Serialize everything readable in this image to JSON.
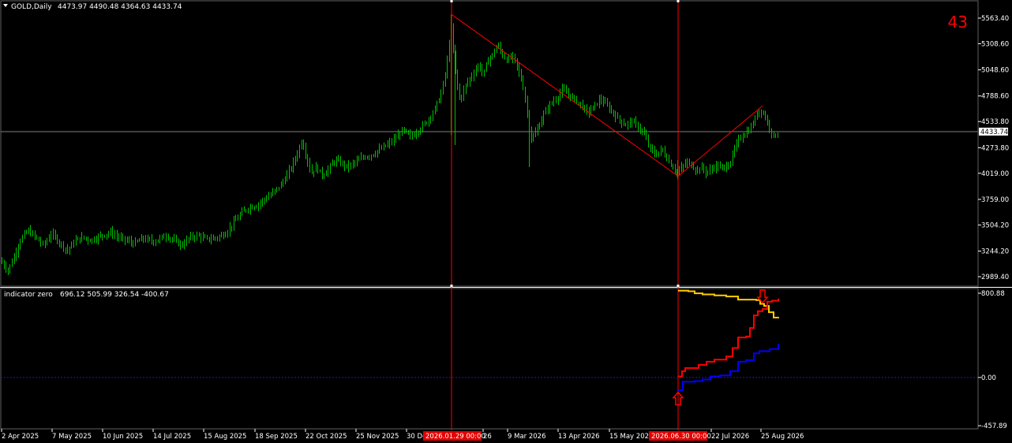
{
  "window": {
    "symbol_title": "GOLD,Daily",
    "ohlc": "4473.97 4490.48 4364.63 4433.74",
    "counter": "43"
  },
  "indicator": {
    "title": "indicator zero",
    "values": "696.12 505.99 326.54 -400.67"
  },
  "colors": {
    "background": "#000000",
    "candle": "#00c000",
    "price_line": "#808080",
    "vline": "#ff0000",
    "trend": "#ff0000",
    "ind_yellow": "#ffcc00",
    "ind_red": "#ff0000",
    "ind_blue": "#0000ff",
    "zero_line": "#2020a0"
  },
  "chart_data": [
    {
      "type": "candlestick",
      "title": "GOLD,Daily",
      "ylim": [
        2900,
        5650
      ],
      "y_ticks": [
        "5563.40",
        "5308.60",
        "5048.60",
        "4788.60",
        "4533.80",
        "4273.80",
        "4019.00",
        "3759.00",
        "3504.20",
        "3244.20",
        "2989.40"
      ],
      "y_tick_values": [
        5563.4,
        5308.6,
        5048.6,
        4788.6,
        4533.8,
        4273.8,
        4019.0,
        3759.0,
        3504.2,
        3244.2,
        2989.4
      ],
      "x_labels": [
        "2 Apr 2025",
        "7 May 2025",
        "10 Jun 2025",
        "14 Jul 2025",
        "15 Aug 2025",
        "18 Sep 2025",
        "22 Oct 2025",
        "25 Nov 2025",
        "30 De",
        "26",
        "9 Mar 2026",
        "13 Apr 2026",
        "15 May 2026",
        "22 Jul 2026",
        "25 Aug 2026"
      ],
      "vertical_markers": [
        "2026.01.29 00:00",
        "2026.06.30 00:00"
      ],
      "current_price": "4433.74",
      "current_price_value": 4433.74,
      "close_path": [
        [
          0,
          3150
        ],
        [
          10,
          3050
        ],
        [
          18,
          3200
        ],
        [
          25,
          3350
        ],
        [
          35,
          3450
        ],
        [
          45,
          3380
        ],
        [
          55,
          3300
        ],
        [
          65,
          3420
        ],
        [
          75,
          3330
        ],
        [
          85,
          3250
        ],
        [
          95,
          3350
        ],
        [
          105,
          3380
        ],
        [
          115,
          3350
        ],
        [
          125,
          3390
        ],
        [
          140,
          3430
        ],
        [
          150,
          3380
        ],
        [
          160,
          3350
        ],
        [
          170,
          3320
        ],
        [
          180,
          3370
        ],
        [
          195,
          3340
        ],
        [
          210,
          3400
        ],
        [
          220,
          3350
        ],
        [
          230,
          3300
        ],
        [
          240,
          3380
        ],
        [
          250,
          3400
        ],
        [
          262,
          3360
        ],
        [
          275,
          3380
        ],
        [
          285,
          3420
        ],
        [
          295,
          3520
        ],
        [
          305,
          3620
        ],
        [
          315,
          3680
        ],
        [
          325,
          3700
        ],
        [
          335,
          3760
        ],
        [
          345,
          3820
        ],
        [
          355,
          3900
        ],
        [
          362,
          3980
        ],
        [
          370,
          4100
        ],
        [
          377,
          4230
        ],
        [
          382,
          4350
        ],
        [
          388,
          4180
        ],
        [
          394,
          4020
        ],
        [
          400,
          4080
        ],
        [
          408,
          4000
        ],
        [
          416,
          4060
        ],
        [
          424,
          4150
        ],
        [
          432,
          4120
        ],
        [
          440,
          4080
        ],
        [
          450,
          4130
        ],
        [
          460,
          4180
        ],
        [
          470,
          4200
        ],
        [
          480,
          4250
        ],
        [
          490,
          4300
        ],
        [
          500,
          4360
        ],
        [
          510,
          4450
        ],
        [
          520,
          4380
        ],
        [
          530,
          4450
        ],
        [
          540,
          4530
        ],
        [
          550,
          4650
        ],
        [
          558,
          4800
        ],
        [
          565,
          5050
        ],
        [
          571,
          5480
        ],
        [
          576,
          5050
        ],
        [
          582,
          4750
        ],
        [
          590,
          4900
        ],
        [
          598,
          5000
        ],
        [
          606,
          5100
        ],
        [
          612,
          5000
        ],
        [
          618,
          5150
        ],
        [
          624,
          5200
        ],
        [
          630,
          5300
        ],
        [
          636,
          5200
        ],
        [
          642,
          5150
        ],
        [
          650,
          5180
        ],
        [
          656,
          5050
        ],
        [
          662,
          4900
        ],
        [
          668,
          4600
        ],
        [
          673,
          4350
        ],
        [
          680,
          4450
        ],
        [
          688,
          4600
        ],
        [
          696,
          4700
        ],
        [
          704,
          4760
        ],
        [
          712,
          4850
        ],
        [
          720,
          4800
        ],
        [
          728,
          4750
        ],
        [
          736,
          4700
        ],
        [
          744,
          4620
        ],
        [
          752,
          4680
        ],
        [
          760,
          4760
        ],
        [
          768,
          4700
        ],
        [
          776,
          4620
        ],
        [
          784,
          4550
        ],
        [
          792,
          4500
        ],
        [
          800,
          4540
        ],
        [
          808,
          4480
        ],
        [
          815,
          4420
        ],
        [
          822,
          4280
        ],
        [
          830,
          4200
        ],
        [
          838,
          4260
        ],
        [
          846,
          4150
        ],
        [
          852,
          4080
        ],
        [
          858,
          4030
        ],
        [
          864,
          4080
        ],
        [
          870,
          4130
        ],
        [
          876,
          4100
        ],
        [
          882,
          4050
        ],
        [
          888,
          4080
        ],
        [
          894,
          4030
        ],
        [
          900,
          4050
        ],
        [
          906,
          4100
        ],
        [
          914,
          4070
        ],
        [
          920,
          4090
        ],
        [
          926,
          4150
        ],
        [
          932,
          4300
        ],
        [
          938,
          4380
        ],
        [
          944,
          4420
        ],
        [
          950,
          4460
        ],
        [
          956,
          4560
        ],
        [
          962,
          4660
        ],
        [
          968,
          4600
        ],
        [
          974,
          4480
        ],
        [
          980,
          4380
        ],
        [
          986,
          4433.74
        ]
      ],
      "trendlines": [
        {
          "from": [
            "2026.01.29",
            5600
          ],
          "to": [
            "2026.06.30",
            3990
          ]
        },
        {
          "from": [
            "2026.06.30",
            3990
          ],
          "to": [
            "2026.09",
            4690
          ]
        }
      ]
    },
    {
      "type": "line",
      "title": "indicator zero",
      "ylim": [
        -457.89,
        880
      ],
      "y_ticks": [
        "800.88",
        "0.00",
        "-457.89"
      ],
      "y_tick_values": [
        800.88,
        0.0,
        -457.89
      ],
      "zero_line": 0,
      "series": [
        {
          "color": "#ffcc00",
          "values": [
            [
              859,
              825
            ],
            [
              872,
              820
            ],
            [
              880,
              800
            ],
            [
              890,
              790
            ],
            [
              905,
              780
            ],
            [
              920,
              770
            ],
            [
              935,
              740
            ],
            [
              950,
              740
            ],
            [
              958,
              735
            ],
            [
              963,
              700
            ],
            [
              968,
              680
            ],
            [
              974,
              620
            ],
            [
              980,
              570
            ],
            [
              986,
              575
            ]
          ]
        },
        {
          "color": "#ff0000",
          "values": [
            [
              859,
              10
            ],
            [
              864,
              60
            ],
            [
              868,
              90
            ],
            [
              885,
              120
            ],
            [
              895,
              150
            ],
            [
              905,
              170
            ],
            [
              920,
              200
            ],
            [
              928,
              280
            ],
            [
              935,
              380
            ],
            [
              945,
              390
            ],
            [
              950,
              470
            ],
            [
              955,
              590
            ],
            [
              960,
              630
            ],
            [
              966,
              650
            ],
            [
              972,
              720
            ],
            [
              978,
              730
            ],
            [
              986,
              750
            ]
          ]
        },
        {
          "color": "#0000ff",
          "values": [
            [
              859,
              -120
            ],
            [
              865,
              -40
            ],
            [
              880,
              -35
            ],
            [
              890,
              -20
            ],
            [
              900,
              10
            ],
            [
              912,
              20
            ],
            [
              925,
              60
            ],
            [
              935,
              150
            ],
            [
              945,
              165
            ],
            [
              955,
              230
            ],
            [
              962,
              250
            ],
            [
              975,
              270
            ],
            [
              986,
              320
            ]
          ]
        }
      ],
      "signals": [
        {
          "type": "up-arrow",
          "x": 859,
          "value": -200
        },
        {
          "type": "down-arrow",
          "x": 966,
          "value": 770
        }
      ]
    }
  ]
}
